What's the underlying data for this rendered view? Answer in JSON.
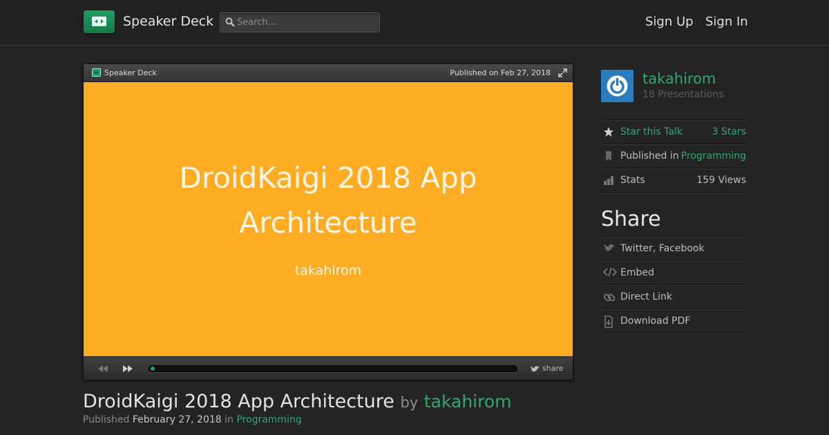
{
  "header": {
    "brand": "Speaker Deck",
    "search_placeholder": "Search...",
    "sign_up": "Sign Up",
    "sign_in": "Sign In"
  },
  "player": {
    "brand": "Speaker Deck",
    "published": "Published on Feb 27, 2018",
    "slide_title": "DroidKaigi 2018 App Architecture",
    "slide_author": "takahirom",
    "share_label": "share",
    "progress": 0.01
  },
  "talk": {
    "title": "DroidKaigi 2018 App Architecture",
    "by": "by",
    "author": "takahirom",
    "published_prefix": "Published",
    "published_date": "February 27, 2018",
    "in_word": "in",
    "category": "Programming"
  },
  "sidebar": {
    "username": "takahirom",
    "presentations": "18 Presentations",
    "star_label": "Star this Talk",
    "star_count": "3 Stars",
    "published_in_label": "Published in",
    "published_in_value": "Programming",
    "stats_label": "Stats",
    "stats_value": "159 Views",
    "share_heading": "Share",
    "share_items": [
      "Twitter, Facebook",
      "Embed",
      "Direct Link",
      "Download PDF"
    ]
  },
  "colors": {
    "accent": "#33a86e",
    "slide_bg": "#fdac23",
    "avatar_bg": "#2b7bbf",
    "page_bg": "#242424"
  },
  "icons": [
    "deck-logo-icon",
    "search-icon",
    "expand-icon",
    "prev-icon",
    "next-icon",
    "twitter-icon",
    "star-icon",
    "bookmark-icon",
    "stats-icon",
    "code-icon",
    "link-icon",
    "download-icon"
  ]
}
